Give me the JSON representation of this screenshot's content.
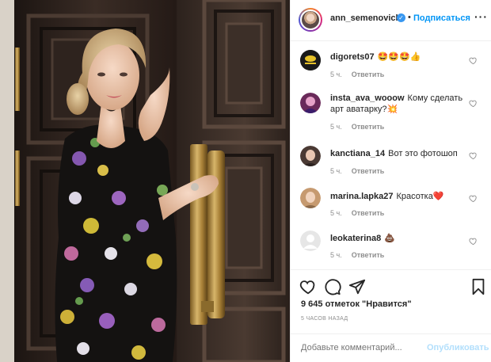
{
  "post": {
    "username": "ann_semenovich",
    "verified_mark": "✓",
    "separator": "•",
    "follow_label": "Подписаться",
    "more_label": "···",
    "likes_text": "9 645 отметок \"Нравится\"",
    "time_ago": "5 ЧАСОВ НАЗАД"
  },
  "comments": [
    {
      "user": "digorets07",
      "text": "🤩🤩🤩👍",
      "time": "5 ч.",
      "reply": "Ответить",
      "avatar": "badge-avatar"
    },
    {
      "user": "insta_ava_wooow",
      "text": "Кому сделать арт аватарку?💥",
      "time": "5 ч.",
      "reply": "Ответить",
      "avatar": "art-avatar"
    },
    {
      "user": "kanctiana_14",
      "text": "Вот это фотошоп",
      "time": "5 ч.",
      "reply": "Ответить",
      "avatar": "woman-avatar"
    },
    {
      "user": "marina.lapka27",
      "text": "Красотка❤️",
      "time": "5 ч.",
      "reply": "Ответить",
      "avatar": "woman-avatar"
    },
    {
      "user": "leokaterina8",
      "text": "💩",
      "time": "5 ч.",
      "reply": "Ответить",
      "avatar": "default-avatar"
    }
  ],
  "add_comment": {
    "placeholder": "Добавьте комментарий...",
    "post_label": "Опубликовать"
  },
  "icons": {
    "like": "heart-icon",
    "comment": "comment-bubble-icon",
    "share": "share-paper-plane-icon",
    "save": "bookmark-icon",
    "more": "more-options-icon"
  },
  "colors": {
    "accent_blue": "#0095f6",
    "post_disabled": "#b2dffc",
    "meta_gray": "#8e8e8e",
    "text": "#262626"
  }
}
